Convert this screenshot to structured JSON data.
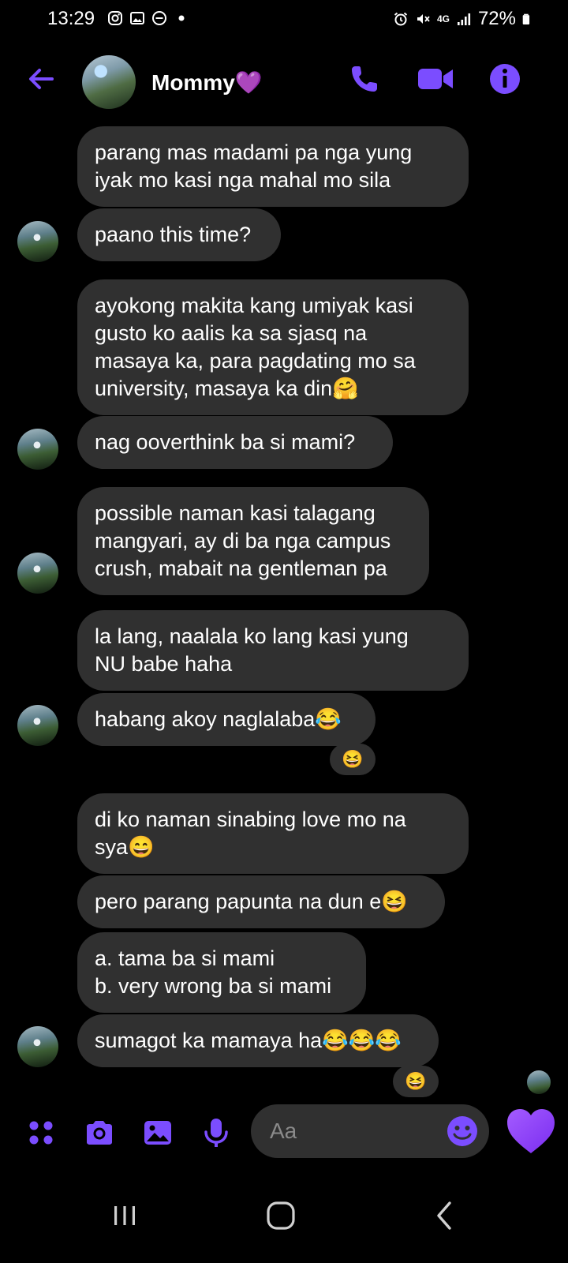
{
  "status": {
    "time": "13:29",
    "battery": "72%",
    "network": "4G"
  },
  "header": {
    "contact_name": "Mommy💜",
    "icons": [
      "back-arrow-icon",
      "phone-icon",
      "video-camera-icon",
      "info-icon"
    ]
  },
  "messages": [
    {
      "text": "parang mas madami pa nga yung\niyak mo kasi nga mahal mo sila"
    },
    {
      "text": "paano this time?"
    },
    {
      "text": "ayokong makita kang umiyak kasi\ngusto ko aalis ka sa sjasq na\nmasaya ka, para pagdating mo sa\nuniversity, masaya ka din🤗"
    },
    {
      "text": "nag ooverthink ba si mami?"
    },
    {
      "text": "possible naman kasi talagang\nmangyari, ay di ba nga campus\ncrush, mabait na gentleman pa"
    },
    {
      "text": "la lang, naalala ko lang kasi yung\nNU babe haha"
    },
    {
      "text": "habang akoy naglalaba😂"
    },
    {
      "text": "di ko naman sinabing love mo na\nsya😄"
    },
    {
      "text": "pero parang papunta na dun e😆"
    },
    {
      "text": "a. tama ba si mami\nb. very wrong ba si mami"
    },
    {
      "text": "sumagot ka mamaya ha😂😂😂"
    }
  ],
  "reactions": [
    "😆",
    "😆"
  ],
  "composer": {
    "placeholder": "Aa",
    "icons": [
      "apps-icon",
      "camera-icon",
      "gallery-icon",
      "microphone-icon",
      "emoji-icon",
      "heart-icon"
    ]
  },
  "colors": {
    "accent": "#7b4dff",
    "bubble": "#303030",
    "background": "#000000",
    "heart": "#8a3cff"
  }
}
